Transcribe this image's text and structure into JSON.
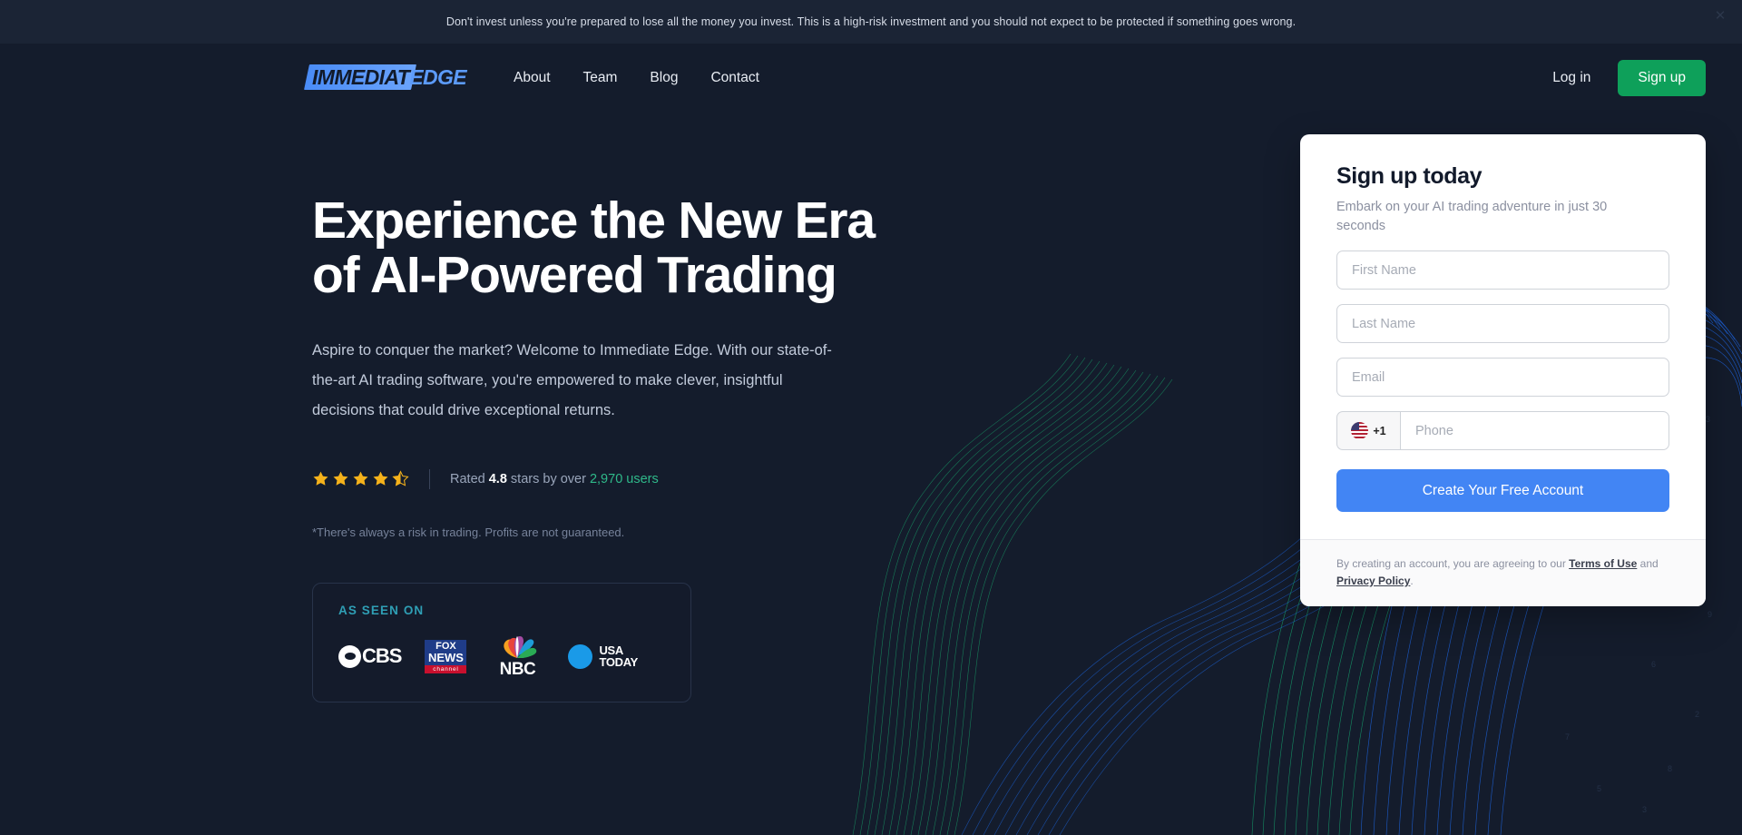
{
  "disclaimer": {
    "text": "Don't invest unless you're prepared to lose all the money you invest. This is a high-risk investment and you should not expect to be protected if something goes wrong.",
    "close_icon": "close-icon",
    "close_glyph": "✕",
    "background": "#1b2435"
  },
  "header": {
    "logo": {
      "part_one": "IMMEDIAT",
      "part_two": "EDGE",
      "highlight_color": "#4a8cf7",
      "text_color": "#5c9bfa"
    },
    "nav": [
      {
        "label": "About"
      },
      {
        "label": "Team"
      },
      {
        "label": "Blog"
      },
      {
        "label": "Contact"
      }
    ],
    "login_label": "Log in",
    "signup_label": "Sign up",
    "signup_color": "#0ea05a"
  },
  "hero": {
    "title": "Experience the New Era of AI-Powered Trading",
    "subtitle": "Aspire to conquer the market? Welcome to Immediate Edge. With our state-of-the-art AI trading software, you're empowered to make clever, insightful decisions that could drive exceptional returns.",
    "rating": {
      "stars_filled": 4,
      "stars_half": 1,
      "stars_total": 5,
      "star_color": "#f5b21b",
      "prefix": "Rated ",
      "score": "4.8",
      "middle": " stars by over ",
      "users": "2,970 users",
      "users_color": "#2fb98a"
    },
    "risk_note": "*There's always a risk in trading. Profits are not guaranteed.",
    "as_seen_on": {
      "label": "AS SEEN ON",
      "label_color": "#2f9fb5",
      "logos": [
        {
          "name": "cbs-logo",
          "text": "CBS"
        },
        {
          "name": "fox-news-logo",
          "line1": "FOX",
          "line2": "NEWS",
          "line3": "channel"
        },
        {
          "name": "nbc-logo",
          "text": "NBC"
        },
        {
          "name": "usa-today-logo",
          "line1": "USA",
          "line2": "TODAY"
        }
      ]
    }
  },
  "signup_form": {
    "title": "Sign up today",
    "subtitle": "Embark on your AI trading adventure in just 30 seconds",
    "fields": {
      "first_name_placeholder": "First Name",
      "last_name_placeholder": "Last Name",
      "email_placeholder": "Email",
      "phone_placeholder": "Phone",
      "phone_prefix": "+1",
      "phone_country_icon": "us-flag-icon"
    },
    "submit_label": "Create Your Free Account",
    "submit_color": "#4285f4",
    "terms": {
      "prefix": "By creating an account, you are agreeing to our ",
      "terms_link": "Terms of Use",
      "middle": " and ",
      "privacy_link": "Privacy Policy",
      "suffix": "."
    }
  }
}
